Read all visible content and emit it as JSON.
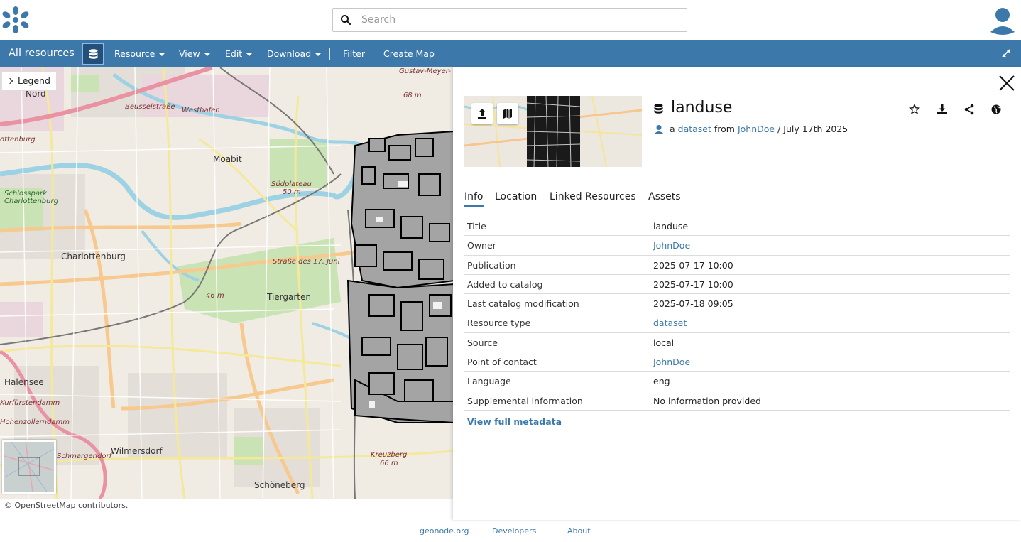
{
  "search": {
    "placeholder": "Search"
  },
  "toolbar": {
    "title": "All resources",
    "items": [
      "Resource",
      "View",
      "Edit",
      "Download",
      "Filter",
      "Create Map"
    ]
  },
  "map": {
    "legend_label": "Legend",
    "attribution": "© OpenStreetMap contributors.",
    "labels": [
      "Moabit",
      "Charlottenburg",
      "Tiergarten",
      "Halensee",
      "Wilmersdorf",
      "Schöneberg",
      "Beusselstraße",
      "Westhafen",
      "Südplateau",
      "50 m",
      "Schlosspark Charlottenburg",
      "Gustav-Meyer-",
      "68 m",
      "Kreuzberg",
      "66 m",
      "Schmargendorf",
      "Kurfürstendamm",
      "Hohenzollerndamm",
      "46 m",
      "Straße des 17. Juni",
      "Nord",
      "ottenburg"
    ]
  },
  "resource": {
    "title": "landuse",
    "meta_prefix": "a",
    "type_link": "dataset",
    "from_word": "from",
    "owner_link": "JohnDoe",
    "date": "/ July 17th 2025"
  },
  "tabs": [
    "Info",
    "Location",
    "Linked Resources",
    "Assets"
  ],
  "info_rows": [
    {
      "key": "Title",
      "value": "landuse",
      "link": false
    },
    {
      "key": "Owner",
      "value": "JohnDoe",
      "link": true
    },
    {
      "key": "Publication",
      "value": "2025-07-17 10:00",
      "link": false
    },
    {
      "key": "Added to catalog",
      "value": "2025-07-17 10:00",
      "link": false
    },
    {
      "key": "Last catalog modification",
      "value": "2025-07-18 09:05",
      "link": false
    },
    {
      "key": "Resource type",
      "value": "dataset",
      "link": true
    },
    {
      "key": "Source",
      "value": "local",
      "link": false
    },
    {
      "key": "Point of contact",
      "value": "JohnDoe",
      "link": true
    },
    {
      "key": "Language",
      "value": "eng",
      "link": false
    },
    {
      "key": "Supplemental information",
      "value": "No information provided",
      "link": false
    }
  ],
  "view_full_metadata": "View full metadata",
  "footer": [
    "geonode.org",
    "Developers",
    "About"
  ],
  "colors": {
    "primary": "#3c79aa",
    "link": "#3c79aa"
  }
}
